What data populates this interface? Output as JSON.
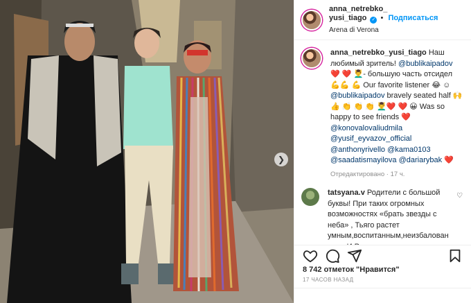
{
  "post": {
    "username": "anna_netrebko_yusi_tiago",
    "username_line1": "anna_netrebko_",
    "username_line2": "yusi_tiago",
    "verified": true,
    "follow_label": "Подписаться",
    "location": "Arena di Verona"
  },
  "caption": {
    "username": "anna_netrebko_yusi_tiago",
    "text_1": " Наш любимый зритель! ",
    "mention_1": "@bublikaipadov",
    "text_2": " ❤️ ❤️ 💆‍♂️- большую часть отсидел 💪💪 💪 Our favorite listener 😂 ☺ ",
    "mention_2": "@bublikaipadov",
    "text_3": " bravely seated half 🙌 👍 👏 👏 👏 💆‍♂️❤️ ❤️ 😀 Was so happy to see friends ❤️ ",
    "mention_3": "@konovalovaliudmila",
    "mention_4": "@yusif_eyvazov_official",
    "mention_5": "@anthonyrivello",
    "mention_6": "@kama0103",
    "mention_7": "@saadatismayilova",
    "mention_8": "@dariarybak",
    "edited": "Отредактировано · 17 ч."
  },
  "comment": {
    "username": "tatsyana.v",
    "text": " Родители с большой буквы! При таких огромных возможностях «брать звезды с неба» , Тьяго растет умным,воспитанным,неизбалован ным. И Родители служат ему"
  },
  "stats": {
    "likes": "8 742 отметок \"Нравится\"",
    "time": "17 ЧАСОВ НАЗАД"
  },
  "icons": {
    "like": "heart-icon",
    "comment": "comment-icon",
    "share": "share-icon",
    "save": "bookmark-icon",
    "next": "chevron-right-icon"
  },
  "colors": {
    "accent": "#0095f6",
    "mention": "#00376b",
    "heart": "#ed4956",
    "muted": "#8e8e8e"
  }
}
